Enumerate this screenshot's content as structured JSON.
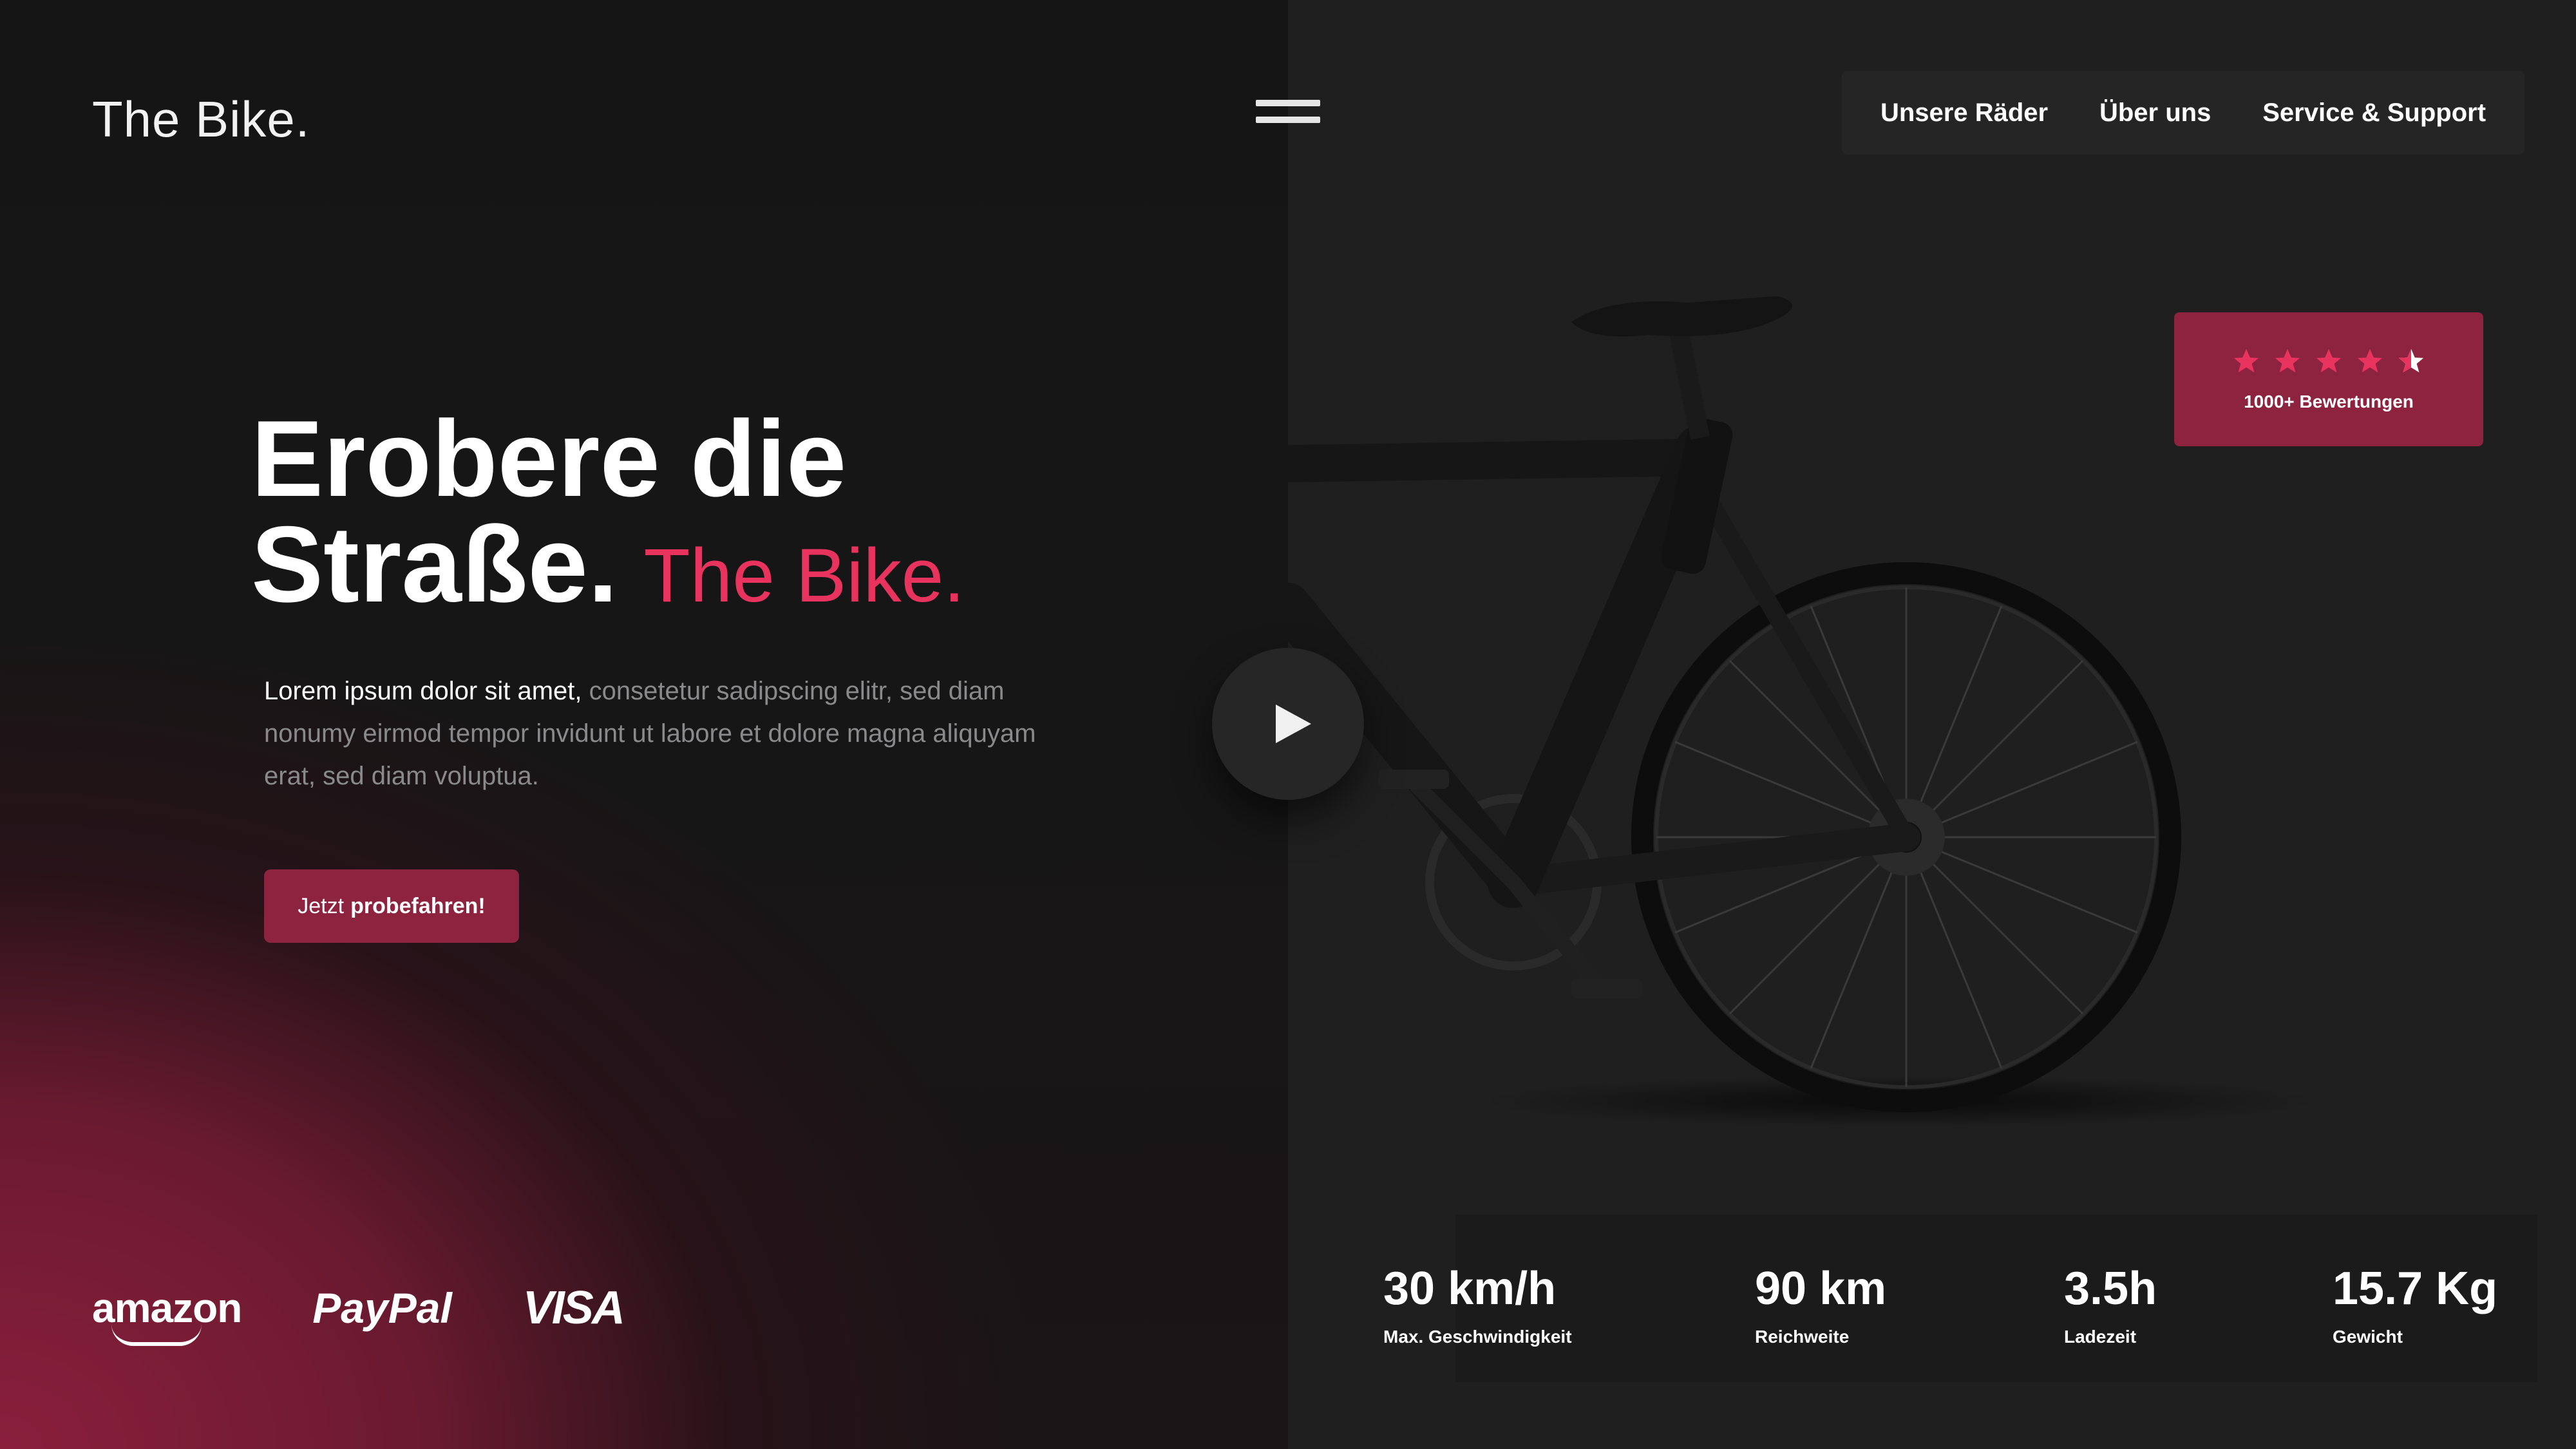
{
  "brand": {
    "logo_text": "The Bike."
  },
  "nav": {
    "items": [
      {
        "label": "Unsere Räder"
      },
      {
        "label": "Über uns"
      },
      {
        "label": "Service  & Support"
      }
    ]
  },
  "hero": {
    "headline_line1": "Erobere die",
    "headline_line2": "Straße.",
    "headline_accent": "The Bike.",
    "lead_strong": "Lorem ipsum dolor sit amet,",
    "lead_rest": " consetetur sadipscing elitr, sed diam nonumy eirmod tempor invidunt ut labore et dolore magna aliquyam erat, sed diam voluptua.",
    "cta_prefix": "Jetzt",
    "cta_bold": "probefahren!"
  },
  "partners": [
    {
      "name": "amazon"
    },
    {
      "name": "PayPal"
    },
    {
      "name": "VISA"
    }
  ],
  "rating": {
    "stars": 4.5,
    "text": "1000+ Bewertungen"
  },
  "specs": [
    {
      "value": "30 km/h",
      "label": "Max. Geschwindigkeit"
    },
    {
      "value": "90 km",
      "label": "Reichweite"
    },
    {
      "value": "3.5h",
      "label": "Ladezeit"
    },
    {
      "value": "15.7 Kg",
      "label": "Gewicht"
    }
  ],
  "icons": {
    "menu": "hamburger-icon",
    "play": "play-icon",
    "star": "star-icon"
  },
  "colors": {
    "accent": "#e8335f",
    "brand_red": "#8e2340",
    "background": "#1c1c1d"
  }
}
